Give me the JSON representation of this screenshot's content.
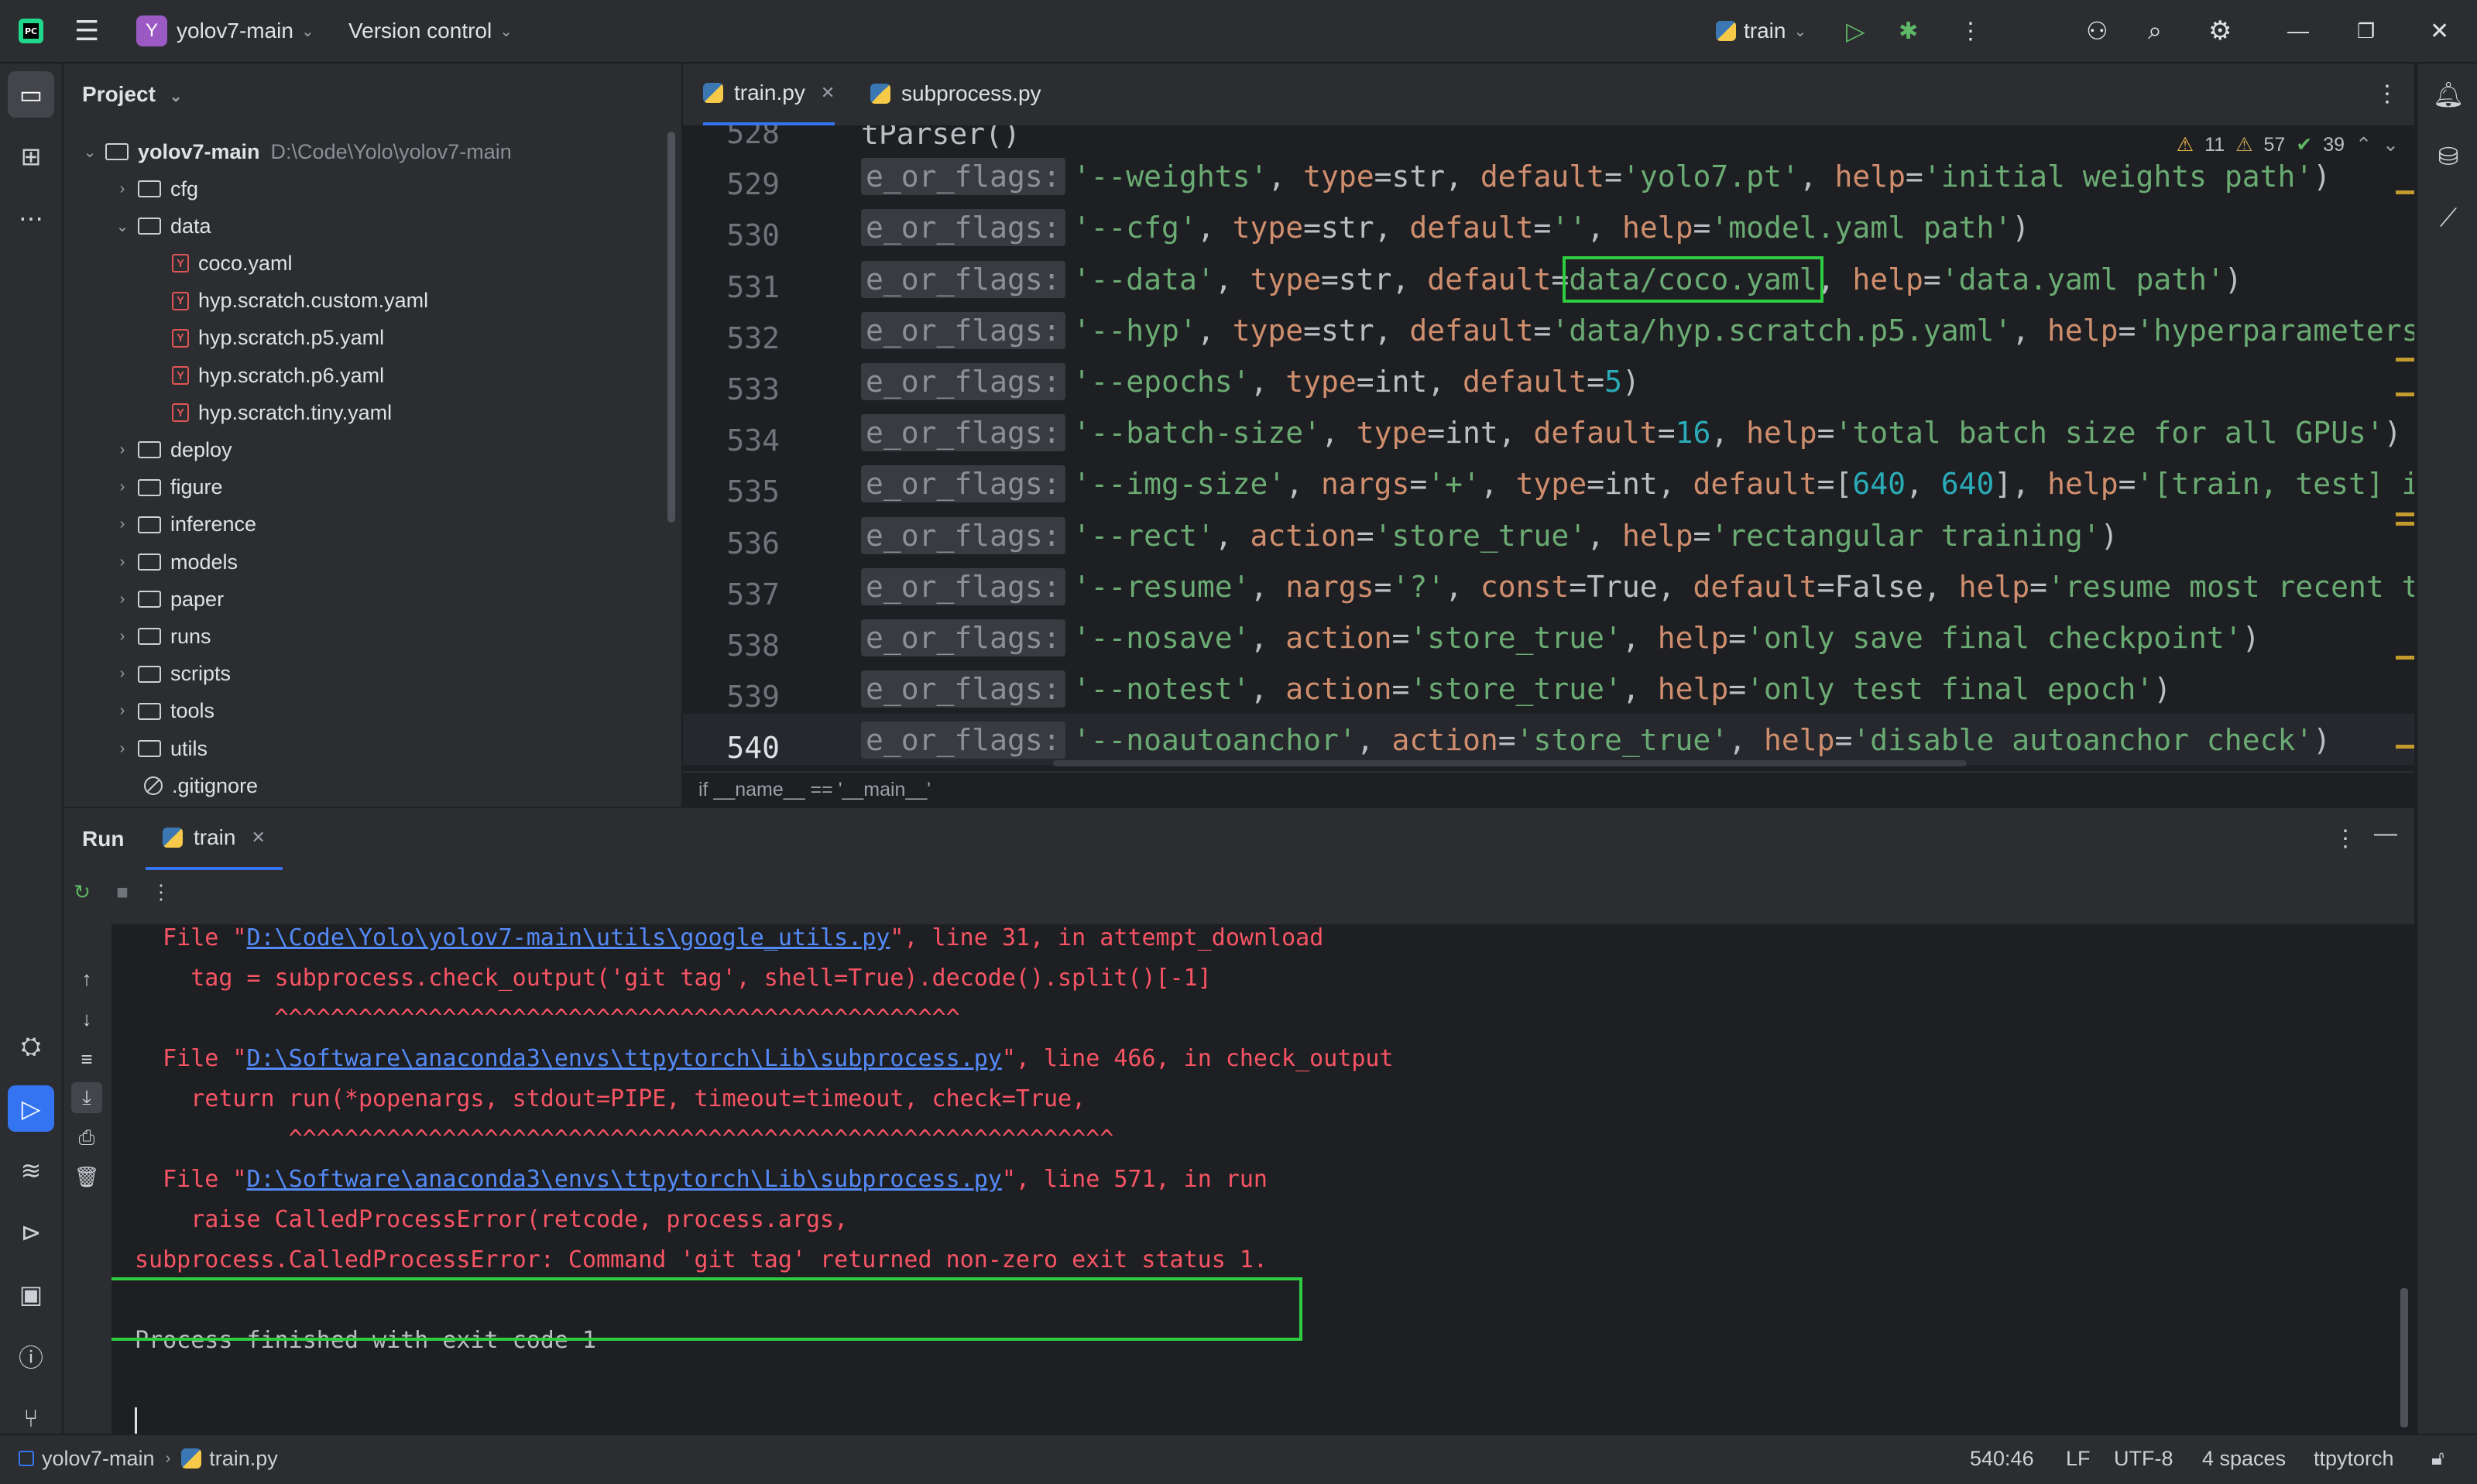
{
  "titlebar": {
    "project_initial": "Y",
    "project_name": "yolov7-main",
    "vcs": "Version control",
    "run_config": "train"
  },
  "project_panel": {
    "title": "Project",
    "root": {
      "name": "yolov7-main",
      "path": "D:\\Code\\Yolo\\yolov7-main"
    },
    "items": [
      {
        "label": "cfg",
        "kind": "folder",
        "expanded": false
      },
      {
        "label": "data",
        "kind": "folder",
        "expanded": true
      },
      {
        "label": "coco.yaml",
        "kind": "yaml"
      },
      {
        "label": "hyp.scratch.custom.yaml",
        "kind": "yaml"
      },
      {
        "label": "hyp.scratch.p5.yaml",
        "kind": "yaml"
      },
      {
        "label": "hyp.scratch.p6.yaml",
        "kind": "yaml"
      },
      {
        "label": "hyp.scratch.tiny.yaml",
        "kind": "yaml"
      },
      {
        "label": "deploy",
        "kind": "folder",
        "expanded": false
      },
      {
        "label": "figure",
        "kind": "folder",
        "expanded": false
      },
      {
        "label": "inference",
        "kind": "folder",
        "expanded": false
      },
      {
        "label": "models",
        "kind": "folder",
        "expanded": false
      },
      {
        "label": "paper",
        "kind": "folder",
        "expanded": false
      },
      {
        "label": "runs",
        "kind": "folder",
        "expanded": false
      },
      {
        "label": "scripts",
        "kind": "folder",
        "expanded": false
      },
      {
        "label": "tools",
        "kind": "folder",
        "expanded": false
      },
      {
        "label": "utils",
        "kind": "folder",
        "expanded": false
      },
      {
        "label": ".gitignore",
        "kind": "ignore"
      }
    ]
  },
  "editor": {
    "tabs": [
      {
        "label": "train.py",
        "active": true
      },
      {
        "label": "subprocess.py",
        "active": false
      }
    ],
    "inspections": {
      "warnings": "11",
      "weak_warnings": "57",
      "typos": "39"
    },
    "top_partial": "tParser()",
    "line_numbers": [
      "528",
      "529",
      "530",
      "531",
      "532",
      "533",
      "534",
      "535",
      "536",
      "537",
      "538",
      "539",
      "540"
    ],
    "hint": "e_or_flags:",
    "code": {
      "l529": [
        "'--weights'",
        ", ",
        "type",
        "=str, ",
        "default",
        "=",
        "'yolo7.pt'",
        ", ",
        "help",
        "=",
        "'initial weights path'",
        ")"
      ],
      "l530": [
        "'--cfg'",
        ", ",
        "type",
        "=str, ",
        "default",
        "=",
        "''",
        ", ",
        "help",
        "=",
        "'model.yaml path'",
        ")"
      ],
      "l531": [
        "'--data'",
        ", ",
        "type",
        "=str, ",
        "default",
        "=",
        "data/coco.yaml",
        ", ",
        "help",
        "=",
        "'data.yaml path'",
        ")"
      ],
      "l532": [
        "'--hyp'",
        ", ",
        "type",
        "=str, ",
        "default",
        "=",
        "'data/hyp.scratch.p5.yaml'",
        ", ",
        "help",
        "=",
        "'hyperparameters"
      ],
      "l533": [
        "'--epochs'",
        ", ",
        "type",
        "=int, ",
        "default",
        "=",
        "5",
        ")"
      ],
      "l534": [
        "'--batch-size'",
        ", ",
        "type",
        "=int, ",
        "default",
        "=",
        "16",
        ", ",
        "help",
        "=",
        "'total batch size for all GPUs'",
        ")"
      ],
      "l535": [
        "'--img-size'",
        ", ",
        "nargs",
        "=",
        "'+'",
        ", ",
        "type",
        "=int, ",
        "default",
        "=[",
        "640",
        ", ",
        "640",
        "], ",
        "help",
        "=",
        "'[train, test] i"
      ],
      "l536": [
        "'--rect'",
        ", ",
        "action",
        "=",
        "'store_true'",
        ", ",
        "help",
        "=",
        "'rectangular training'",
        ")"
      ],
      "l537": [
        "'--resume'",
        ", ",
        "nargs",
        "=",
        "'?'",
        ", ",
        "const",
        "=True, ",
        "default",
        "=False, ",
        "help",
        "=",
        "'resume most recent t"
      ],
      "l538": [
        "'--nosave'",
        ", ",
        "action",
        "=",
        "'store_true'",
        ", ",
        "help",
        "=",
        "'only save final checkpoint'",
        ")"
      ],
      "l539": [
        "'--notest'",
        ", ",
        "action",
        "=",
        "'store_true'",
        ", ",
        "help",
        "=",
        "'only test final epoch'",
        ")"
      ],
      "l540": [
        "'--noautoanchor'",
        ", ",
        "action",
        "=",
        "'store_true'",
        ", ",
        "help",
        "=",
        "'disable autoanchor check'",
        ")"
      ]
    },
    "breadcrumb": "if __name__ == '__main__'"
  },
  "run": {
    "title": "Run",
    "tab": "train",
    "output": {
      "f1_pre": "  File \"",
      "f1_link": "D:\\Code\\Yolo\\yolov7-main\\utils\\google_utils.py",
      "f1_post": "\", line 31, in attempt_download",
      "f1_code": "    tag = subprocess.check_output('git tag', shell=True).decode().split()[-1]",
      "f1_caret": "          ^^^^^^^^^^^^^^^^^^^^^^^^^^^^^^^^^^^^^^^^^^^^^^^^^",
      "f2_pre": "  File \"",
      "f2_link": "D:\\Software\\anaconda3\\envs\\ttpytorch\\Lib\\subprocess.py",
      "f2_post": "\", line 466, in check_output",
      "f2_code": "    return run(*popenargs, stdout=PIPE, timeout=timeout, check=True,",
      "f2_caret": "           ^^^^^^^^^^^^^^^^^^^^^^^^^^^^^^^^^^^^^^^^^^^^^^^^^^^^^^^^^^^",
      "f3_pre": "  File \"",
      "f3_link": "D:\\Software\\anaconda3\\envs\\ttpytorch\\Lib\\subprocess.py",
      "f3_post": "\", line 571, in run",
      "f3_code": "    raise CalledProcessError(retcode, process.args,",
      "error": "subprocess.CalledProcessError: Command 'git tag' returned non-zero exit status 1.",
      "finished": "Process finished with exit code 1"
    }
  },
  "statusbar": {
    "crumb_project": "yolov7-main",
    "crumb_file": "train.py",
    "position": "540:46",
    "line_sep": "LF",
    "encoding": "UTF-8",
    "indent": "4 spaces",
    "interpreter": "ttpytorch"
  }
}
